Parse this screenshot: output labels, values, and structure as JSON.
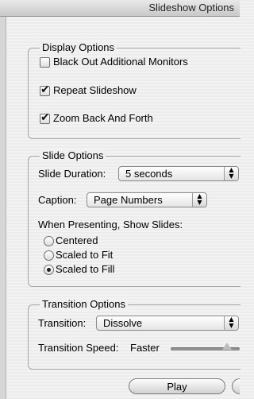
{
  "window": {
    "title": "Slideshow Options"
  },
  "display_options": {
    "title": "Display Options",
    "black_out": {
      "label": "Black Out Additional Monitors",
      "checked": false
    },
    "repeat": {
      "label": "Repeat Slideshow",
      "checked": true
    },
    "zoom": {
      "label": "Zoom Back And Forth",
      "checked": true
    }
  },
  "slide_options": {
    "title": "Slide Options",
    "duration_label": "Slide Duration:",
    "duration_value": "5 seconds",
    "caption_label": "Caption:",
    "caption_value": "Page Numbers",
    "presenting_label": "When Presenting, Show Slides:",
    "radio_options": [
      "Centered",
      "Scaled to Fit",
      "Scaled to Fill"
    ],
    "selected_option": "Scaled to Fill"
  },
  "transition_options": {
    "title": "Transition Options",
    "transition_label": "Transition:",
    "transition_value": "Dissolve",
    "speed_label": "Transition Speed:",
    "speed_value": "Faster"
  },
  "buttons": {
    "play": "Play"
  },
  "icons": {
    "stepper": "popup-stepper-icon",
    "check": "checkmark-icon"
  }
}
